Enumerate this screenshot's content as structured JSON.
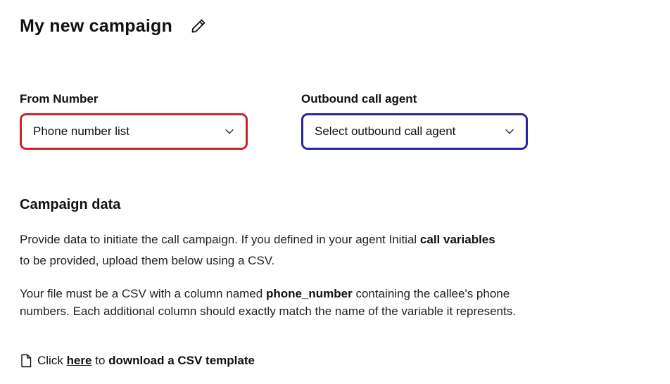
{
  "header": {
    "title": "My new campaign",
    "edit_icon": "pencil-icon"
  },
  "from_number": {
    "label": "From Number",
    "selected": "Phone number list",
    "border_color": "#d21f26"
  },
  "outbound_agent": {
    "label": "Outbound call agent",
    "selected": "Select outbound call agent",
    "border_color": "#2a22a8"
  },
  "campaign_data": {
    "title": "Campaign data",
    "para1": {
      "text_before": "Provide data to initiate the call campaign. If you defined in your agent Initial ",
      "bold": "call variables",
      "text_after": " to be provided, upload them below using a CSV."
    },
    "para2": {
      "text_before": "Your file must be a CSV with a column named ",
      "bold": "phone_number",
      "text_after": " containing the callee's phone numbers. Each additional column should exactly match the name of the variable it represents."
    },
    "download": {
      "icon": "file-icon",
      "prefix": "Click",
      "link_label": "here",
      "middle": "to",
      "bold_tail": "download a CSV template"
    }
  }
}
